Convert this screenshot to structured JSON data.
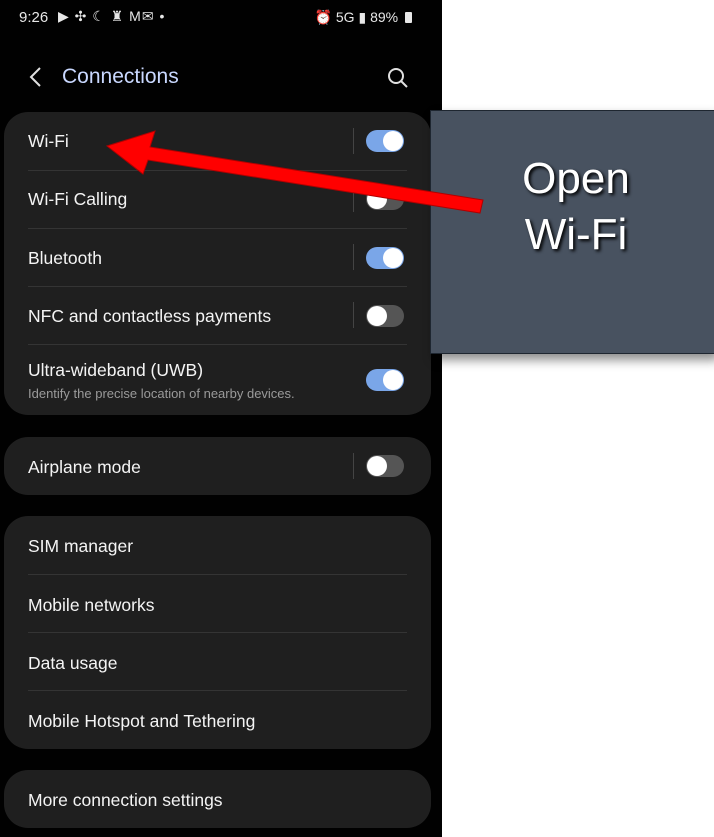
{
  "statusbar": {
    "time": "9:26",
    "notification_icons": "▶ ✣ ☾ ♜ M✉ •",
    "network": "5G",
    "battery": "89%"
  },
  "header": {
    "title": "Connections"
  },
  "group1": [
    {
      "label": "Wi-Fi",
      "toggle": "on"
    },
    {
      "label": "Wi-Fi Calling",
      "toggle": "off"
    },
    {
      "label": "Bluetooth",
      "toggle": "on"
    },
    {
      "label": "NFC and contactless payments",
      "toggle": "off"
    },
    {
      "label": "Ultra-wideband (UWB)",
      "sub": "Identify the precise location of nearby devices.",
      "toggle": "on"
    }
  ],
  "group2": [
    {
      "label": "Airplane mode",
      "toggle": "off"
    }
  ],
  "group3": [
    {
      "label": "SIM manager"
    },
    {
      "label": "Mobile networks"
    },
    {
      "label": "Data usage"
    },
    {
      "label": "Mobile Hotspot and Tethering"
    }
  ],
  "group4": [
    {
      "label": "More connection settings"
    }
  ],
  "callout": {
    "line1": "Open",
    "line2": "Wi-Fi"
  },
  "colors": {
    "accent": "#7aa6e8",
    "arrow": "#ff0000",
    "callout_bg": "#485260"
  }
}
